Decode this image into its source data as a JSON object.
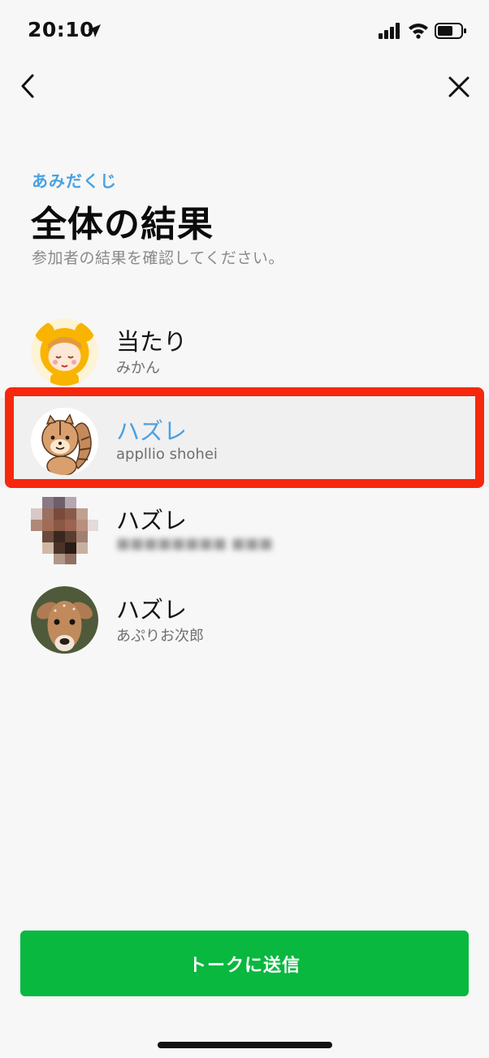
{
  "status_bar": {
    "time": "20:10"
  },
  "header": {
    "eyebrow": "あみだくじ",
    "title": "全体の結果",
    "description": "参加者の結果を確認してください。"
  },
  "results": [
    {
      "result": "当たり",
      "name": "みかん",
      "avatar": "cartoon-girl-bear-hood-avatar"
    },
    {
      "result": "ハズレ",
      "name": "appllio shohei",
      "avatar": "cartoon-chipmunk-avatar",
      "highlighted": true
    },
    {
      "result": "ハズレ",
      "name": "■■■■■■■■ ■■■",
      "avatar": "pixelated-photo-avatar",
      "obscured": true
    },
    {
      "result": "ハズレ",
      "name": "あぷりお次郎",
      "avatar": "deer-photo-avatar"
    }
  ],
  "footer": {
    "send_button": "トークに送信"
  },
  "colors": {
    "accent_blue": "#4aa1e2",
    "primary_green": "#08b83f",
    "annotation_red": "#f5280e"
  }
}
